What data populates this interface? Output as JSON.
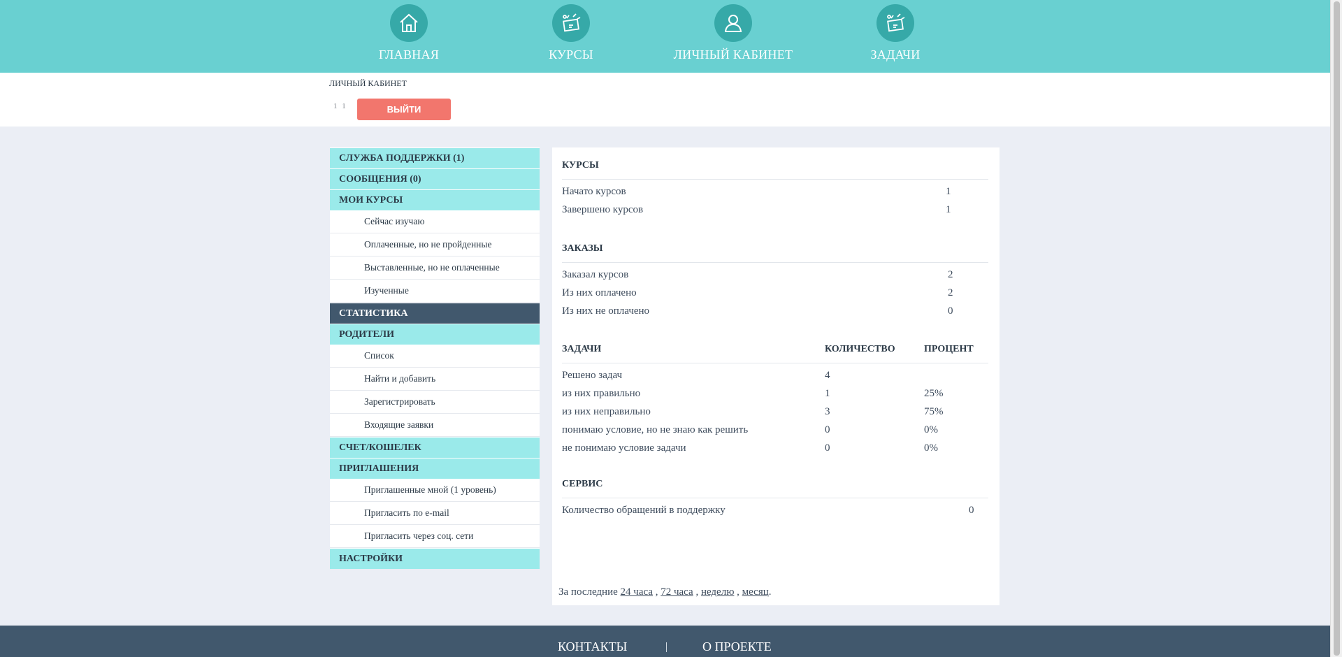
{
  "nav": [
    {
      "label": "ГЛАВНАЯ",
      "icon": "home-icon"
    },
    {
      "label": "КУРСЫ",
      "icon": "courses-icon"
    },
    {
      "label": "ЛИЧНЫЙ КАБИНЕТ",
      "icon": "user-icon"
    },
    {
      "label": "ЗАДАЧИ",
      "icon": "tasks-icon"
    }
  ],
  "userbar": {
    "breadcrumb": "ЛИЧНЫЙ КАБИНЕТ",
    "user_id": "1 1",
    "logout_label": "ВЫЙТИ"
  },
  "sidebar": {
    "support": "СЛУЖБА ПОДДЕРЖКИ (1)",
    "messages": "СООБЩЕНИЯ (0)",
    "my_courses": "МОИ КУРСЫ",
    "my_courses_items": [
      "Сейчас изучаю",
      "Оплаченные, но не пройденные",
      "Выставленные, но не оплаченные",
      "Изученные"
    ],
    "statistics": "СТАТИСТИКА",
    "parents": "РОДИТЕЛИ",
    "parents_items": [
      "Список",
      "Найти и добавить",
      "Зарегистрировать",
      "Входящие заявки"
    ],
    "wallet": "СЧЕТ/КОШЕЛЕК",
    "invites": "ПРИГЛАШЕНИЯ",
    "invites_items": [
      "Приглашенные мной (1 уровень)",
      "Пригласить по e-mail",
      "Пригласить через соц. сети"
    ],
    "settings": "НАСТРОЙКИ"
  },
  "stats": {
    "courses": {
      "title": "КУРСЫ",
      "rows": [
        {
          "label": "Начато курсов",
          "value": "1"
        },
        {
          "label": "Завершено курсов",
          "value": "1"
        }
      ]
    },
    "orders": {
      "title": "ЗАКАЗЫ",
      "rows": [
        {
          "label": "Заказал курсов",
          "value": "2"
        },
        {
          "label": "Из них оплачено",
          "value": "2"
        },
        {
          "label": "Из них не оплачено",
          "value": "0"
        }
      ]
    },
    "tasks": {
      "title": "ЗАДАЧИ",
      "col_count": "КОЛИЧЕСТВО",
      "col_percent": "ПРОЦЕНТ",
      "rows": [
        {
          "label": "Решено задач",
          "count": "4",
          "percent": ""
        },
        {
          "label": "из них правильно",
          "count": "1",
          "percent": "25%"
        },
        {
          "label": "из них неправильно",
          "count": "3",
          "percent": "75%"
        },
        {
          "label": "понимаю условие, но не знаю как решить",
          "count": "0",
          "percent": "0%"
        },
        {
          "label": "не понимаю условие задачи",
          "count": "0",
          "percent": "0%"
        }
      ]
    },
    "service": {
      "title": "СЕРВИС",
      "rows": [
        {
          "label": "Количество обращений в поддержку",
          "value": "0"
        }
      ]
    },
    "period": {
      "prefix": "За последние",
      "links": [
        "24 часа",
        "72 часа",
        "неделю",
        "месяц"
      ],
      "sep": " , ",
      "end": "."
    }
  },
  "footer": {
    "contacts": "КОНТАКТЫ",
    "about": "О ПРОЕКТЕ"
  },
  "colors": {
    "nav_bg": "#69d0d1",
    "icon_circle": "#36a9a8",
    "sidebar_head": "#9aeaea",
    "active": "#41586d",
    "logout": "#f2766d"
  }
}
